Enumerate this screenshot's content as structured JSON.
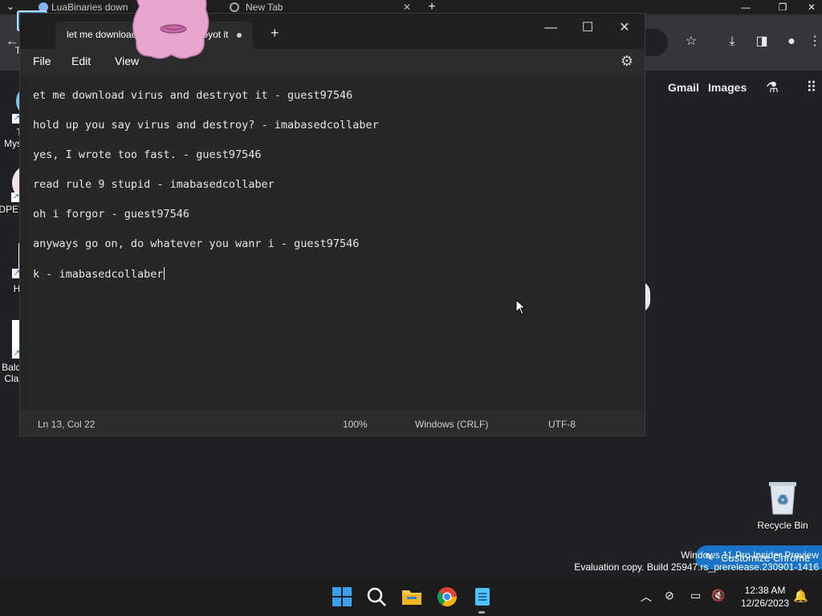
{
  "browser": {
    "tabs": [
      {
        "label": "LuaBinaries down"
      },
      {
        "label": "New Tab"
      }
    ],
    "links": {
      "gmail": "Gmail",
      "images": "Images"
    },
    "customize_label": "Customize Chrome"
  },
  "notepad": {
    "tab_title": "let me download virus and destroyot it",
    "menu": {
      "file": "File",
      "edit": "Edit",
      "view": "View"
    },
    "lines": [
      "et me download virus and destryot it - guest97546",
      "hold up you say virus and destroy? - imabasedcollaber",
      "yes, I wrote too fast. - guest97546",
      "read rule 9 stupid - imabasedcollaber",
      "oh i forgor - guest97546",
      "anyways go on, do whatever you wanr i - guest97546",
      "k - imabasedcollaber"
    ],
    "status": {
      "position": "Ln 13, Col 22",
      "zoom": "100%",
      "line_ending": "Windows (CRLF)",
      "encoding": "UTF-8"
    }
  },
  "desktop": {
    "icons": {
      "this_pc": "This PC",
      "touhou": "Touhou Mystery Reel",
      "dpet": "DPET Desktop P...",
      "half_life": "Half-Life",
      "baldi": "Baldi's Basics Classic Re...",
      "recycle_bin": "Recycle Bin"
    },
    "watermark": {
      "line1": "Windows 11 Pro Insider Preview",
      "line2": "Evaluation copy. Build 25947.rs_prerelease.230901-1416"
    }
  },
  "taskbar": {
    "time": "12:38 AM",
    "date": "12/26/2023"
  }
}
